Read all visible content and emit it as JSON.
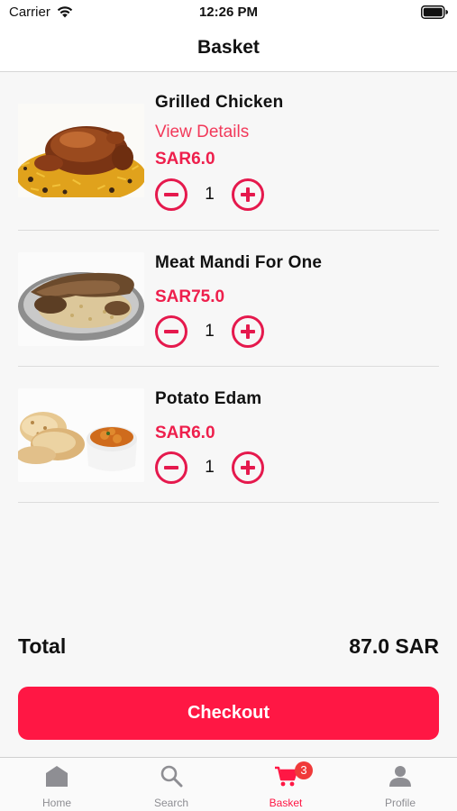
{
  "status_bar": {
    "carrier": "Carrier",
    "time": "12:26 PM"
  },
  "header": {
    "title": "Basket"
  },
  "basket": {
    "items": [
      {
        "name": "Grilled Chicken",
        "details_link": "View Details",
        "price": "SAR6.0",
        "quantity": "1",
        "image": "grilled-chicken-on-rice"
      },
      {
        "name": "Meat Mandi For One",
        "price": "SAR75.0",
        "quantity": "1",
        "image": "meat-mandi-platter"
      },
      {
        "name": "Potato Edam",
        "price": "SAR6.0",
        "quantity": "1",
        "image": "potato-curry-with-bread"
      }
    ]
  },
  "summary": {
    "total_label": "Total",
    "total_value": "87.0 SAR"
  },
  "checkout": {
    "label": "Checkout"
  },
  "tab_bar": {
    "tabs": [
      {
        "label": "Home",
        "icon": "home-icon"
      },
      {
        "label": "Search",
        "icon": "search-icon"
      },
      {
        "label": "Basket",
        "icon": "cart-icon",
        "badge": "3",
        "active": true
      },
      {
        "label": "Profile",
        "icon": "person-icon"
      }
    ]
  },
  "colors": {
    "accent": "#ff1744",
    "price": "#ee1f4c",
    "inactive_tab": "#8e8e93"
  }
}
